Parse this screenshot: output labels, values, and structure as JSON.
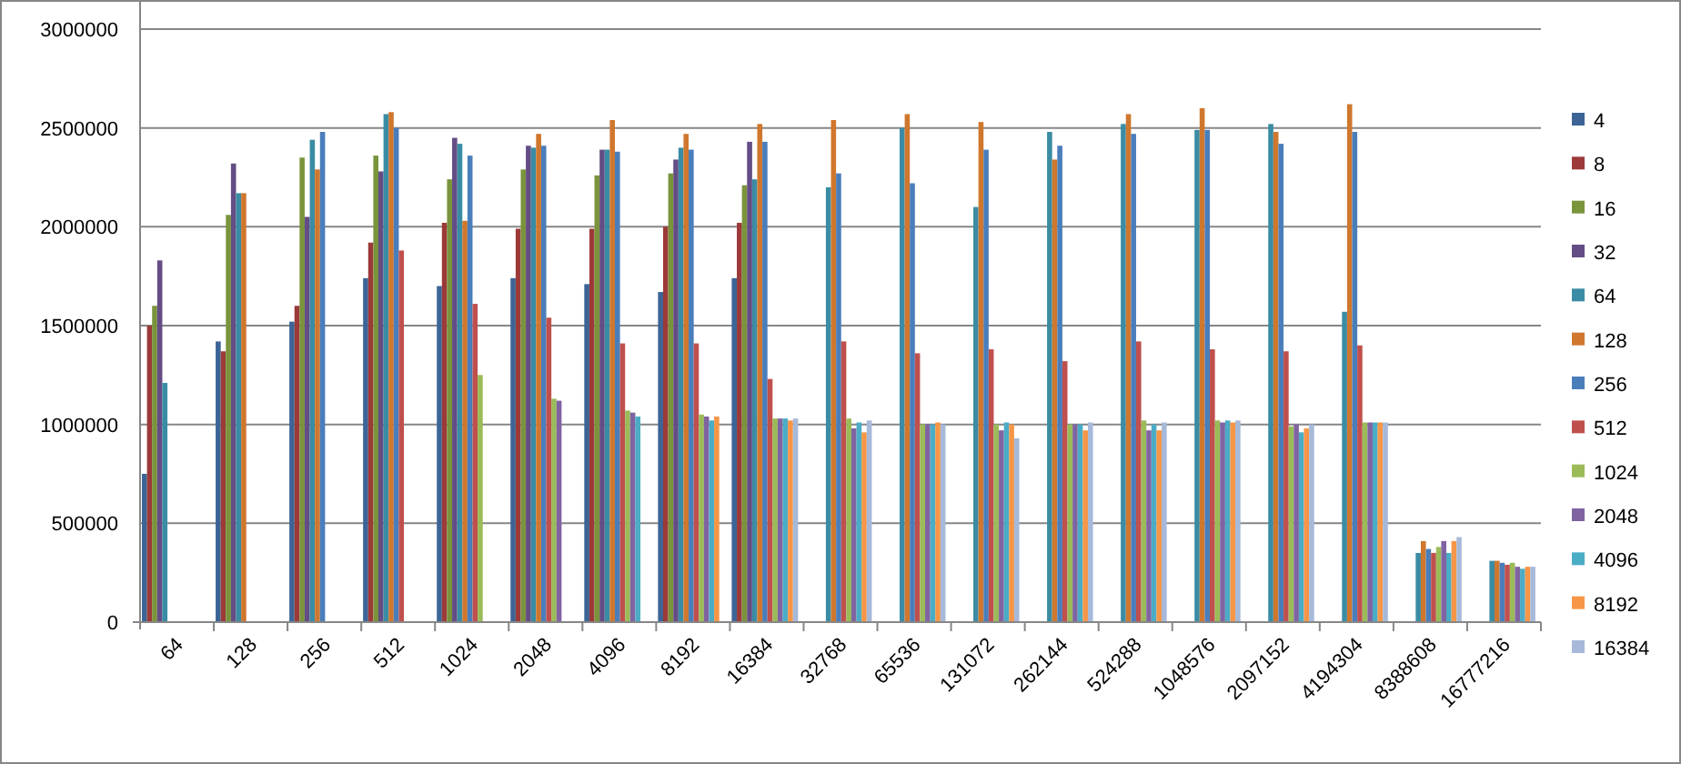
{
  "chart": {
    "chart_data": {
      "type": "bar",
      "orientation": "vertical",
      "grid": true,
      "legend": true,
      "categories": [
        "64",
        "128",
        "256",
        "512",
        "1024",
        "2048",
        "4096",
        "8192",
        "16384",
        "32768",
        "65536",
        "131072",
        "262144",
        "524288",
        "1048576",
        "2097152",
        "4194304",
        "8388608",
        "16777216"
      ],
      "ylim": [
        0,
        3000000
      ],
      "yticks": [
        0,
        500000,
        1000000,
        1500000,
        2000000,
        2500000,
        3000000
      ],
      "series": [
        {
          "name": "4",
          "color": "#3c6496",
          "values": [
            750000,
            1420000,
            1520000,
            1740000,
            1700000,
            1740000,
            1710000,
            1670000,
            1740000,
            null,
            null,
            null,
            null,
            null,
            null,
            null,
            null,
            null,
            null
          ]
        },
        {
          "name": "8",
          "color": "#9b3a38",
          "values": [
            1500000,
            1370000,
            1600000,
            1920000,
            2020000,
            1990000,
            1990000,
            2000000,
            2020000,
            null,
            null,
            null,
            null,
            null,
            null,
            null,
            null,
            null,
            null
          ]
        },
        {
          "name": "16",
          "color": "#7a943c",
          "values": [
            1600000,
            2060000,
            2350000,
            2360000,
            2240000,
            2290000,
            2260000,
            2270000,
            2210000,
            null,
            null,
            null,
            null,
            null,
            null,
            null,
            null,
            null,
            null
          ]
        },
        {
          "name": "32",
          "color": "#644d84",
          "values": [
            1830000,
            2320000,
            2050000,
            2280000,
            2450000,
            2410000,
            2390000,
            2340000,
            2430000,
            null,
            null,
            null,
            null,
            null,
            null,
            null,
            null,
            null,
            null
          ]
        },
        {
          "name": "64",
          "color": "#3a8ca4",
          "values": [
            1210000,
            2170000,
            2440000,
            2570000,
            2420000,
            2400000,
            2390000,
            2400000,
            2240000,
            2200000,
            2500000,
            2100000,
            2480000,
            2520000,
            2490000,
            2520000,
            1570000,
            350000,
            310000
          ]
        },
        {
          "name": "128",
          "color": "#d0772e",
          "values": [
            null,
            2170000,
            2290000,
            2580000,
            2030000,
            2470000,
            2540000,
            2470000,
            2520000,
            2540000,
            2570000,
            2530000,
            2340000,
            2570000,
            2600000,
            2480000,
            2620000,
            410000,
            310000
          ]
        },
        {
          "name": "256",
          "color": "#4a7ebb",
          "values": [
            null,
            null,
            2480000,
            2500000,
            2360000,
            2410000,
            2380000,
            2390000,
            2430000,
            2270000,
            2220000,
            2390000,
            2410000,
            2470000,
            2490000,
            2420000,
            2480000,
            370000,
            300000
          ]
        },
        {
          "name": "512",
          "color": "#c0504d",
          "values": [
            null,
            null,
            null,
            1880000,
            1610000,
            1540000,
            1410000,
            1410000,
            1230000,
            1420000,
            1360000,
            1380000,
            1320000,
            1420000,
            1380000,
            1370000,
            1400000,
            350000,
            290000
          ]
        },
        {
          "name": "1024",
          "color": "#9bbb59",
          "values": [
            null,
            null,
            null,
            null,
            1250000,
            1130000,
            1070000,
            1050000,
            1030000,
            1030000,
            1000000,
            1000000,
            1000000,
            1020000,
            1020000,
            990000,
            1010000,
            380000,
            300000
          ]
        },
        {
          "name": "2048",
          "color": "#8064a2",
          "values": [
            null,
            null,
            null,
            null,
            null,
            1120000,
            1060000,
            1040000,
            1030000,
            980000,
            1000000,
            970000,
            1000000,
            970000,
            1010000,
            1000000,
            1010000,
            410000,
            280000
          ]
        },
        {
          "name": "4096",
          "color": "#4bacc6",
          "values": [
            null,
            null,
            null,
            null,
            null,
            null,
            1040000,
            1020000,
            1030000,
            1010000,
            1000000,
            1010000,
            1000000,
            1000000,
            1020000,
            960000,
            1010000,
            350000,
            270000
          ]
        },
        {
          "name": "8192",
          "color": "#f79646",
          "values": [
            null,
            null,
            null,
            null,
            null,
            null,
            null,
            1040000,
            1020000,
            960000,
            1010000,
            1000000,
            970000,
            970000,
            1010000,
            980000,
            1010000,
            410000,
            280000
          ]
        },
        {
          "name": "16384",
          "color": "#a7b9d9",
          "values": [
            null,
            null,
            null,
            null,
            null,
            null,
            null,
            null,
            1030000,
            1020000,
            1000000,
            930000,
            1010000,
            1010000,
            1020000,
            1000000,
            1010000,
            430000,
            280000
          ]
        }
      ]
    }
  }
}
